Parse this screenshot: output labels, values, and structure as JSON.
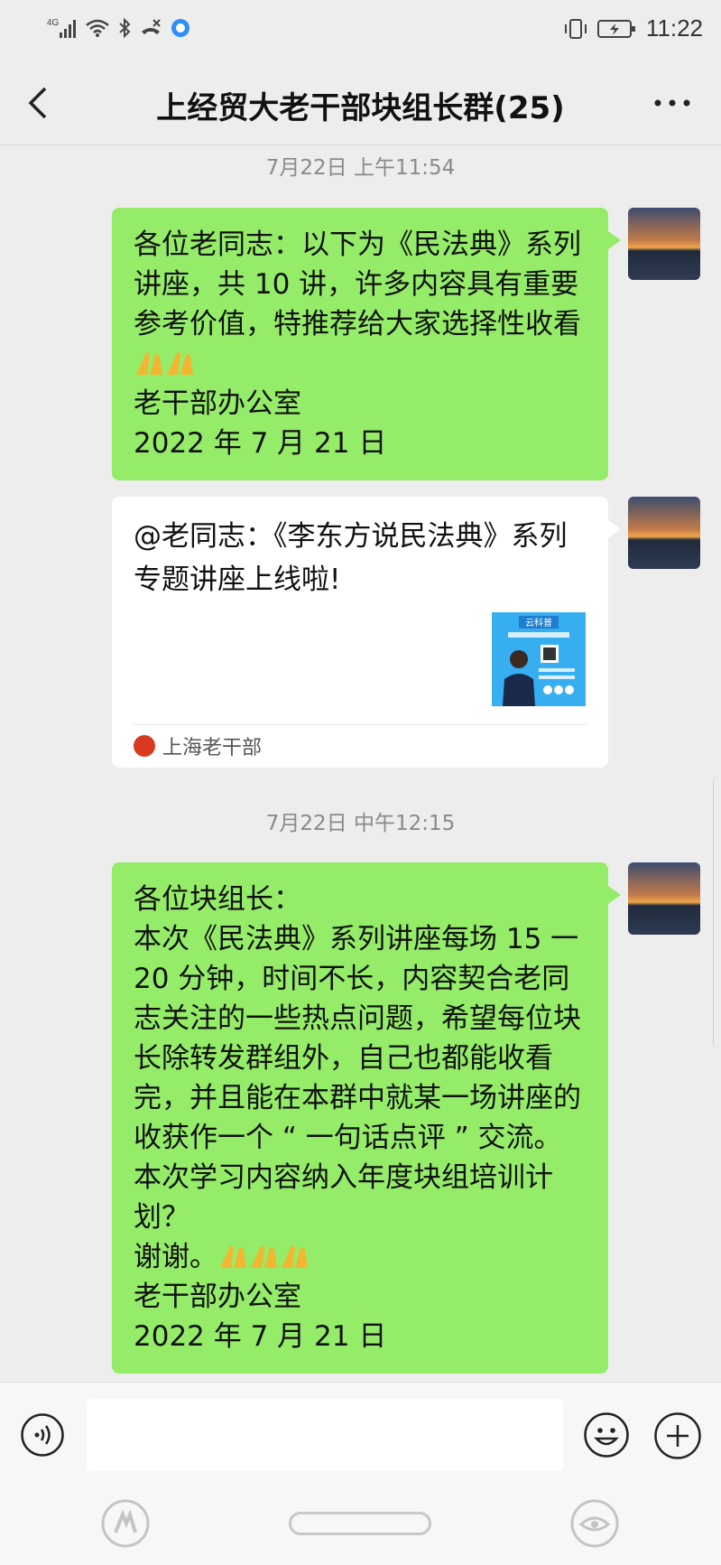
{
  "status_bar": {
    "network": "4G",
    "time": "11:22"
  },
  "header": {
    "title": "上经贸大老干部块组长群(25)"
  },
  "messages": [
    {
      "timestamp": "7月22日 上午11:54",
      "text": "各位老同志：以下为《民法典》系列讲座，共 10 讲，许多内容具有重要参考价值，特推荐给大家选择性收看",
      "emoji_count": 2,
      "tail": "老干部办公室\n2022 年 7 月 21 日"
    },
    {
      "card_title": "@老同志：《李东方说民法典》系列专题讲座上线啦!",
      "card_source": "上海老干部",
      "thumb_label": "云科普"
    },
    {
      "timestamp": "7月22日 中午12:15",
      "text": "各位块组长：\n本次《民法典》系列讲座每场 15 一 20 分钟，时间不长，内容契合老同志关注的一些热点问题，希望每位块长除转发群组外，自己也都能收看完，并且能在本群中就某一场讲座的收获作一个 “ 一句话点评 ” 交流。本次学习内容纳入年度块组培训计划？\n谢谢。",
      "emoji_count": 3,
      "tail": "老干部办公室\n2022 年 7 月 21 日"
    }
  ],
  "colors": {
    "bubble_self": "#95ec69",
    "background": "#ededed",
    "card": "#ffffff"
  },
  "icons": [
    "back-icon",
    "more-icon",
    "voice-icon",
    "emoji-icon",
    "plus-icon"
  ]
}
